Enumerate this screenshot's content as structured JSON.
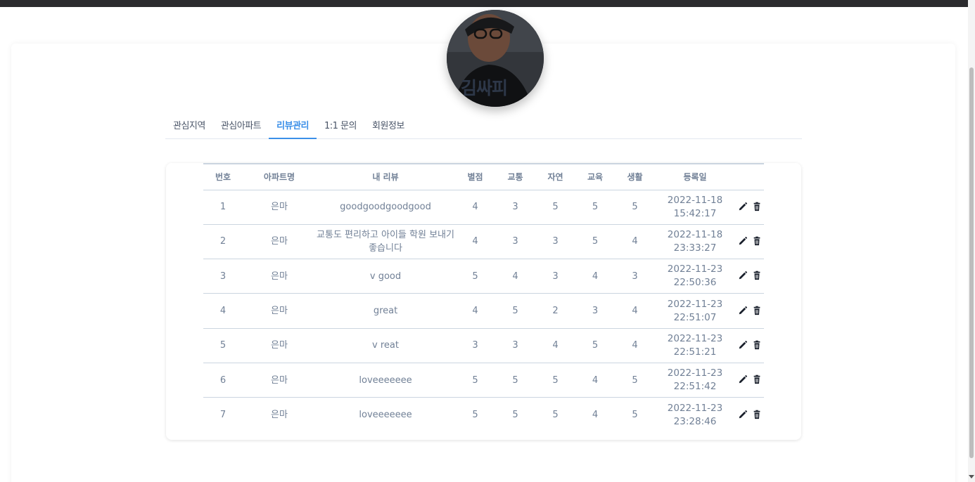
{
  "profile": {
    "name": "김싸피"
  },
  "tabs": [
    {
      "label": "관심지역",
      "active": false
    },
    {
      "label": "관심아파트",
      "active": false
    },
    {
      "label": "리뷰관리",
      "active": true
    },
    {
      "label": "1:1 문의",
      "active": false
    },
    {
      "label": "회원정보",
      "active": false
    }
  ],
  "table": {
    "headers": [
      "번호",
      "아파트명",
      "내 리뷰",
      "별점",
      "교통",
      "자연",
      "교육",
      "생활",
      "등록일",
      ""
    ],
    "rows": [
      {
        "no": "1",
        "apt": "은마",
        "review": "goodgoodgoodgood",
        "rating": "4",
        "transport": "3",
        "nature": "5",
        "education": "5",
        "living": "5",
        "date": "2022-11-18",
        "time": "15:42:17"
      },
      {
        "no": "2",
        "apt": "은마",
        "review": "교통도 편리하고 아이들 학원 보내기 좋습니다",
        "rating": "4",
        "transport": "3",
        "nature": "3",
        "education": "5",
        "living": "4",
        "date": "2022-11-18",
        "time": "23:33:27"
      },
      {
        "no": "3",
        "apt": "은마",
        "review": "v good",
        "rating": "5",
        "transport": "4",
        "nature": "3",
        "education": "4",
        "living": "3",
        "date": "2022-11-23",
        "time": "22:50:36"
      },
      {
        "no": "4",
        "apt": "은마",
        "review": "great",
        "rating": "4",
        "transport": "5",
        "nature": "2",
        "education": "3",
        "living": "4",
        "date": "2022-11-23",
        "time": "22:51:07"
      },
      {
        "no": "5",
        "apt": "은마",
        "review": "v reat",
        "rating": "3",
        "transport": "3",
        "nature": "4",
        "education": "5",
        "living": "4",
        "date": "2022-11-23",
        "time": "22:51:21"
      },
      {
        "no": "6",
        "apt": "은마",
        "review": "loveeeeeee",
        "rating": "5",
        "transport": "5",
        "nature": "5",
        "education": "4",
        "living": "5",
        "date": "2022-11-23",
        "time": "22:51:42"
      },
      {
        "no": "7",
        "apt": "은마",
        "review": "loveeeeeee",
        "rating": "5",
        "transport": "5",
        "nature": "5",
        "education": "4",
        "living": "5",
        "date": "2022-11-23",
        "time": "23:28:46"
      }
    ]
  },
  "icons": {
    "edit": "pencil-icon",
    "delete": "trash-icon"
  },
  "colors": {
    "accent": "#3b8fe8",
    "text": "#718096",
    "heading": "#2d3748"
  }
}
